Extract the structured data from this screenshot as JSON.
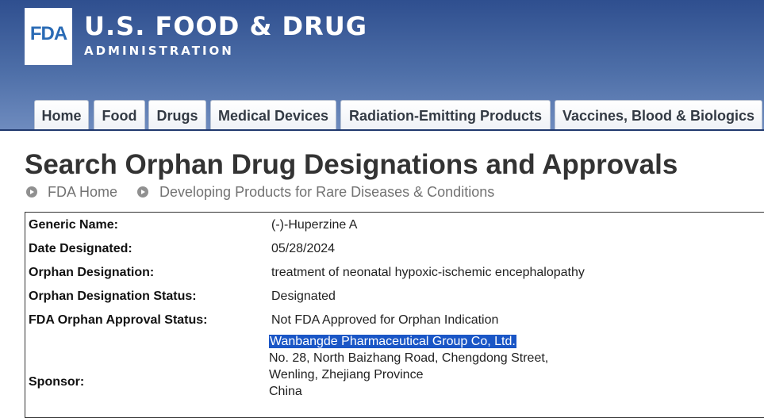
{
  "header": {
    "logo_text": "FDA",
    "agency_name": "U.S. FOOD & DRUG",
    "agency_sub": "ADMINISTRATION"
  },
  "nav": {
    "tabs": [
      {
        "label": "Home"
      },
      {
        "label": "Food"
      },
      {
        "label": "Drugs"
      },
      {
        "label": "Medical Devices"
      },
      {
        "label": "Radiation-Emitting Products"
      },
      {
        "label": "Vaccines, Blood & Biologics"
      }
    ]
  },
  "page": {
    "title": "Search Orphan Drug Designations and Approvals"
  },
  "breadcrumb": [
    {
      "label": "FDA Home"
    },
    {
      "label": "Developing Products for Rare Diseases & Conditions"
    }
  ],
  "details": {
    "generic_name": {
      "label": "Generic Name:",
      "value": "(-)-Huperzine A"
    },
    "date_designated": {
      "label": "Date Designated:",
      "value": "05/28/2024"
    },
    "orphan_designation": {
      "label": "Orphan Designation:",
      "value": "treatment of neonatal hypoxic-ischemic encephalopathy"
    },
    "designation_status": {
      "label": "Orphan Designation Status:",
      "value": "Designated"
    },
    "approval_status": {
      "label": "FDA Orphan Approval Status:",
      "value": "Not FDA Approved for Orphan Indication"
    },
    "sponsor": {
      "label": "Sponsor:",
      "name": "Wanbangde Pharmaceutical Group Co, Ltd.",
      "address_line1": "No. 28, North Baizhang Road, Chengdong Street,",
      "address_line2": "Wenling, Zhejiang Province",
      "country": "China"
    }
  },
  "colors": {
    "header_blue": "#3b5a96",
    "selection_highlight": "#1a56c6",
    "logo_blue": "#2a6bb5"
  }
}
